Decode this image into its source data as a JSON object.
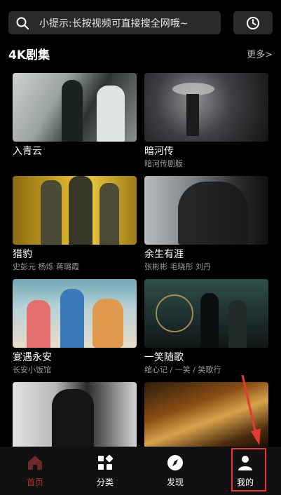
{
  "search": {
    "placeholder_text": "小提示:长按视频可直接搜全网哦~",
    "icon": "search-icon"
  },
  "history": {
    "icon": "clock-icon"
  },
  "section": {
    "title": "4K剧集",
    "more": "更多>"
  },
  "cards": [
    {
      "title": "入青云",
      "subtitle": ""
    },
    {
      "title": "暗河传",
      "subtitle": "暗河传剧版"
    },
    {
      "title": "猎豹",
      "subtitle": "史彭元 杨烁 蒋璐霞"
    },
    {
      "title": "余生有涯",
      "subtitle": "张彬彬 毛晓彤 刘丹"
    },
    {
      "title": "宴遇永安",
      "subtitle": "长安小饭馆"
    },
    {
      "title": "一笑随歌",
      "subtitle": "绾心记 / 一笑 / 笑歌行"
    },
    {
      "title": "",
      "subtitle": ""
    },
    {
      "title": "",
      "subtitle": ""
    }
  ],
  "tabs": [
    {
      "label": "首页",
      "icon": "home-icon",
      "active": true
    },
    {
      "label": "分类",
      "icon": "grid-icon",
      "active": false
    },
    {
      "label": "发现",
      "icon": "compass-icon",
      "active": false
    },
    {
      "label": "我的",
      "icon": "user-icon",
      "active": false
    }
  ],
  "colors": {
    "accent": "#b0352c",
    "annotation": "#e53935",
    "surface": "#2a2a2c"
  }
}
